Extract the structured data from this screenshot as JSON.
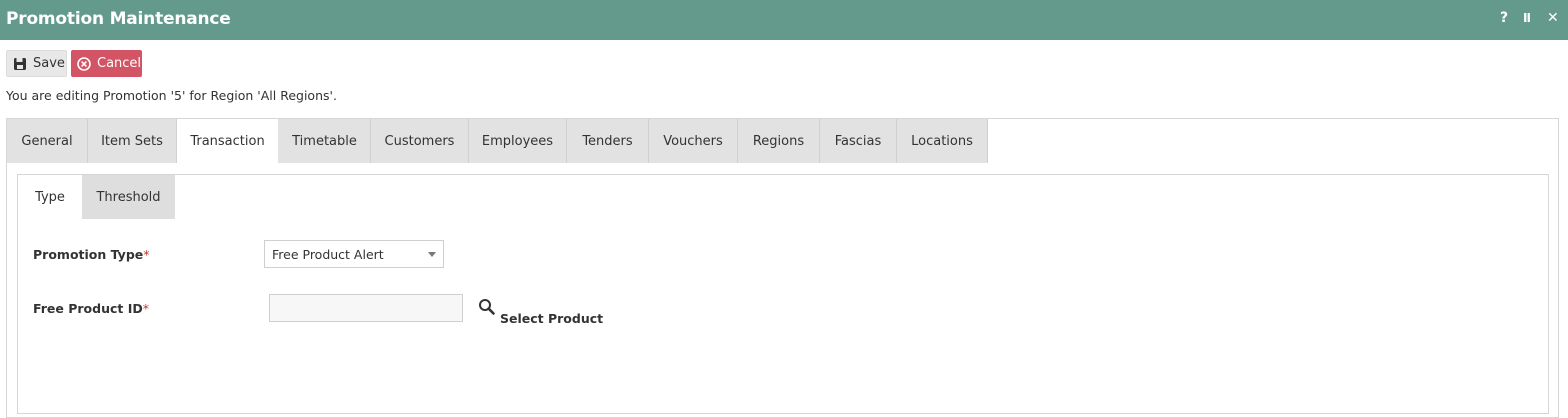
{
  "window": {
    "title": "Promotion Maintenance",
    "help_glyph": "?",
    "pause_glyph": "II",
    "close_glyph": "✕"
  },
  "toolbar": {
    "save_label": "Save",
    "cancel_label": "Cancel",
    "save_icon": "floppy-disk-icon",
    "cancel_icon": "x-circle-icon"
  },
  "status_message": "You are editing Promotion '5' for Region 'All Regions'.",
  "tabs": [
    {
      "label": "General"
    },
    {
      "label": "Item Sets"
    },
    {
      "label": "Transaction",
      "active": true
    },
    {
      "label": "Timetable"
    },
    {
      "label": "Customers"
    },
    {
      "label": "Employees"
    },
    {
      "label": "Tenders"
    },
    {
      "label": "Vouchers"
    },
    {
      "label": "Regions"
    },
    {
      "label": "Fascias"
    },
    {
      "label": "Locations"
    }
  ],
  "subtabs": [
    {
      "label": "Type",
      "active": true
    },
    {
      "label": "Threshold"
    }
  ],
  "form": {
    "promotion_type": {
      "label": "Promotion Type",
      "required_mark": "*",
      "value": "Free Product Alert"
    },
    "free_product_id": {
      "label": "Free Product ID",
      "required_mark": "*",
      "value": "",
      "placeholder": ""
    },
    "select_product_label": "Select Product"
  },
  "colors": {
    "titlebar": "#639a8b",
    "cancel_button": "#d35464",
    "tab_inactive": "#e2e2e2",
    "required": "#c0392b"
  }
}
